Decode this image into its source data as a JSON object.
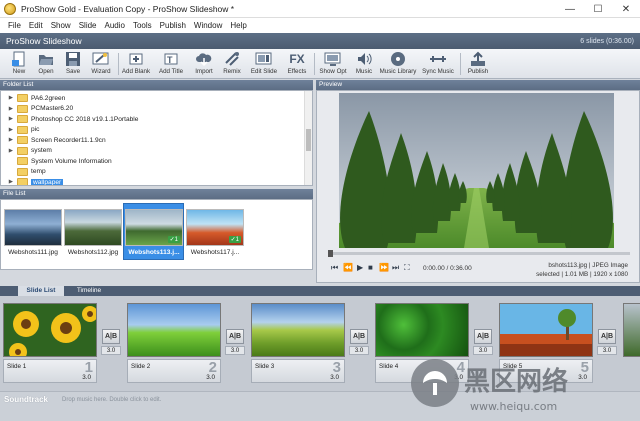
{
  "window": {
    "title": "ProShow Gold - Evaluation Copy - ProShow Slideshow *",
    "minimize": "—",
    "maximize": "☐",
    "close": "✕"
  },
  "menu": [
    "File",
    "Edit",
    "Show",
    "Slide",
    "Audio",
    "Tools",
    "Publish",
    "Window",
    "Help"
  ],
  "show": {
    "title": "ProShow Slideshow",
    "count": "6 slides (0:36.00)"
  },
  "toolbar": {
    "new": "New",
    "open": "Open",
    "save": "Save",
    "wizard": "Wizard",
    "add_blank": "Add Blank",
    "add_title": "Add Title",
    "import": "Import",
    "remix": "Remix",
    "edit_slide": "Edit Slide",
    "effects": "Effects",
    "fx_glyph": "FX",
    "show_opt": "Show Opt",
    "music": "Music",
    "music_library": "Music Library",
    "sync_music": "Sync Music",
    "publish": "Publish"
  },
  "folder_list": {
    "header": "Folder List",
    "items": [
      {
        "label": "PA6.2green",
        "expand": "▶",
        "selected": false
      },
      {
        "label": "PCMaster6.20",
        "expand": "▶",
        "selected": false
      },
      {
        "label": "Photoshop CC 2018 v19.1.1Portable",
        "expand": "▶",
        "selected": false
      },
      {
        "label": "pic",
        "expand": "▶",
        "selected": false
      },
      {
        "label": "Screen Recorder11.1.9cn",
        "expand": "▶",
        "selected": false
      },
      {
        "label": "system",
        "expand": "▶",
        "selected": false
      },
      {
        "label": "System Volume Information",
        "expand": "",
        "selected": false
      },
      {
        "label": "temp",
        "expand": "",
        "selected": false
      },
      {
        "label": "wallpaper",
        "expand": "▶",
        "selected": true
      }
    ]
  },
  "file_list": {
    "header": "File List",
    "files": [
      {
        "name": "Webshots111.jpg",
        "used": false
      },
      {
        "name": "Webshots112.jpg",
        "used": false
      },
      {
        "name": "Webshots113.j...",
        "used": true,
        "badge": "✓1"
      },
      {
        "name": "Webshots117.j...",
        "used": true,
        "badge": "✓1"
      }
    ]
  },
  "preview": {
    "header": "Preview",
    "time": "0:00.00 / 0:36.00",
    "file": "bshots113.jpg  |  JPEG Image",
    "meta": "selected  |  1.01 MB  |  1920 x 1080",
    "progress": 0,
    "controls": {
      "prev": "⏮",
      "rew": "⏪",
      "play": "▶",
      "stop": "■",
      "fwd": "⏩",
      "next": "⏭",
      "full": "⛶"
    }
  },
  "tabs": {
    "slide_list": "Slide List",
    "timeline": "Timeline"
  },
  "slides": [
    {
      "name": "Slide 1",
      "number": "1",
      "duration": "3.0"
    },
    {
      "name": "Slide 2",
      "number": "2",
      "duration": "3.0"
    },
    {
      "name": "Slide 3",
      "number": "3",
      "duration": "3.0"
    },
    {
      "name": "Slide 4",
      "number": "4",
      "duration": "3.0"
    },
    {
      "name": "Slide 5",
      "number": "5",
      "duration": "3.0"
    }
  ],
  "transitions": [
    {
      "label": "A|B",
      "duration": "3.0"
    },
    {
      "label": "A|B",
      "duration": "3.0"
    },
    {
      "label": "A|B",
      "duration": "3.0"
    },
    {
      "label": "A|B",
      "duration": "3.0"
    },
    {
      "label": "A|B",
      "duration": "3.0"
    }
  ],
  "soundtrack": {
    "title": "Soundtrack",
    "hint": "Drop music here.  Double click to edit."
  },
  "watermark": {
    "text": "黑区网络",
    "url": "www.heiqu.com"
  },
  "colors": {
    "accent": "#3a8ee6",
    "header": "#5c6d84",
    "strip": "#c5cad2"
  }
}
